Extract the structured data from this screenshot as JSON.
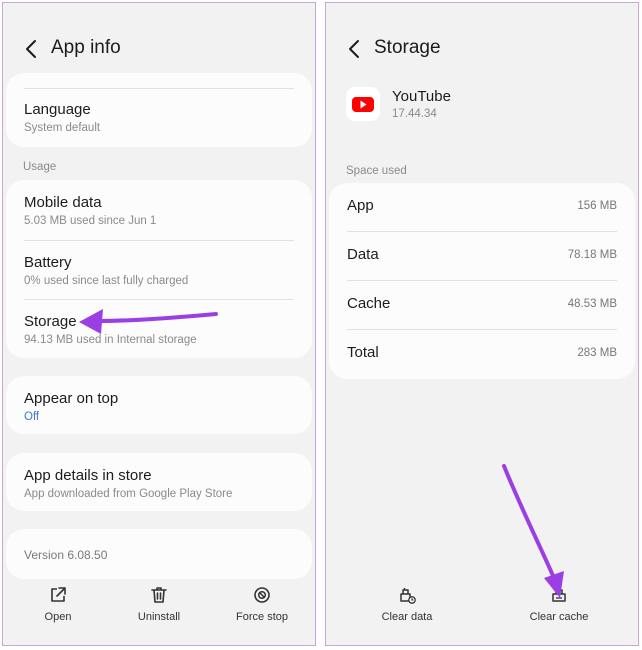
{
  "left": {
    "title": "App info",
    "language": {
      "label": "Language",
      "value": "System default"
    },
    "usage_header": "Usage",
    "mobile_data": {
      "label": "Mobile data",
      "value": "5.03 MB used since Jun 1"
    },
    "battery": {
      "label": "Battery",
      "value": "0% used since last fully charged"
    },
    "storage": {
      "label": "Storage",
      "value": "94.13 MB used in Internal storage"
    },
    "appear_on_top": {
      "label": "Appear on top",
      "value": "Off"
    },
    "app_details": {
      "label": "App details in store",
      "value": "App downloaded from Google Play Store"
    },
    "version": "Version 6.08.50",
    "bottom": {
      "open": "Open",
      "uninstall": "Uninstall",
      "force_stop": "Force stop"
    }
  },
  "right": {
    "title": "Storage",
    "app_name": "YouTube",
    "app_version": "17.44.34",
    "space_used_header": "Space used",
    "rows": [
      {
        "label": "App",
        "value": "156 MB"
      },
      {
        "label": "Data",
        "value": "78.18 MB"
      },
      {
        "label": "Cache",
        "value": "48.53 MB"
      },
      {
        "label": "Total",
        "value": "283 MB"
      }
    ],
    "bottom": {
      "clear_data": "Clear data",
      "clear_cache": "Clear cache"
    }
  },
  "colors": {
    "accent_arrow": "#9b3fe4",
    "link_blue": "#3b7cd6",
    "youtube_red": "#ff0000"
  },
  "icons": [
    "back-arrow-icon",
    "open-external-icon",
    "trash-icon",
    "block-icon",
    "youtube-logo-icon",
    "clear-data-icon",
    "clear-cache-icon"
  ]
}
